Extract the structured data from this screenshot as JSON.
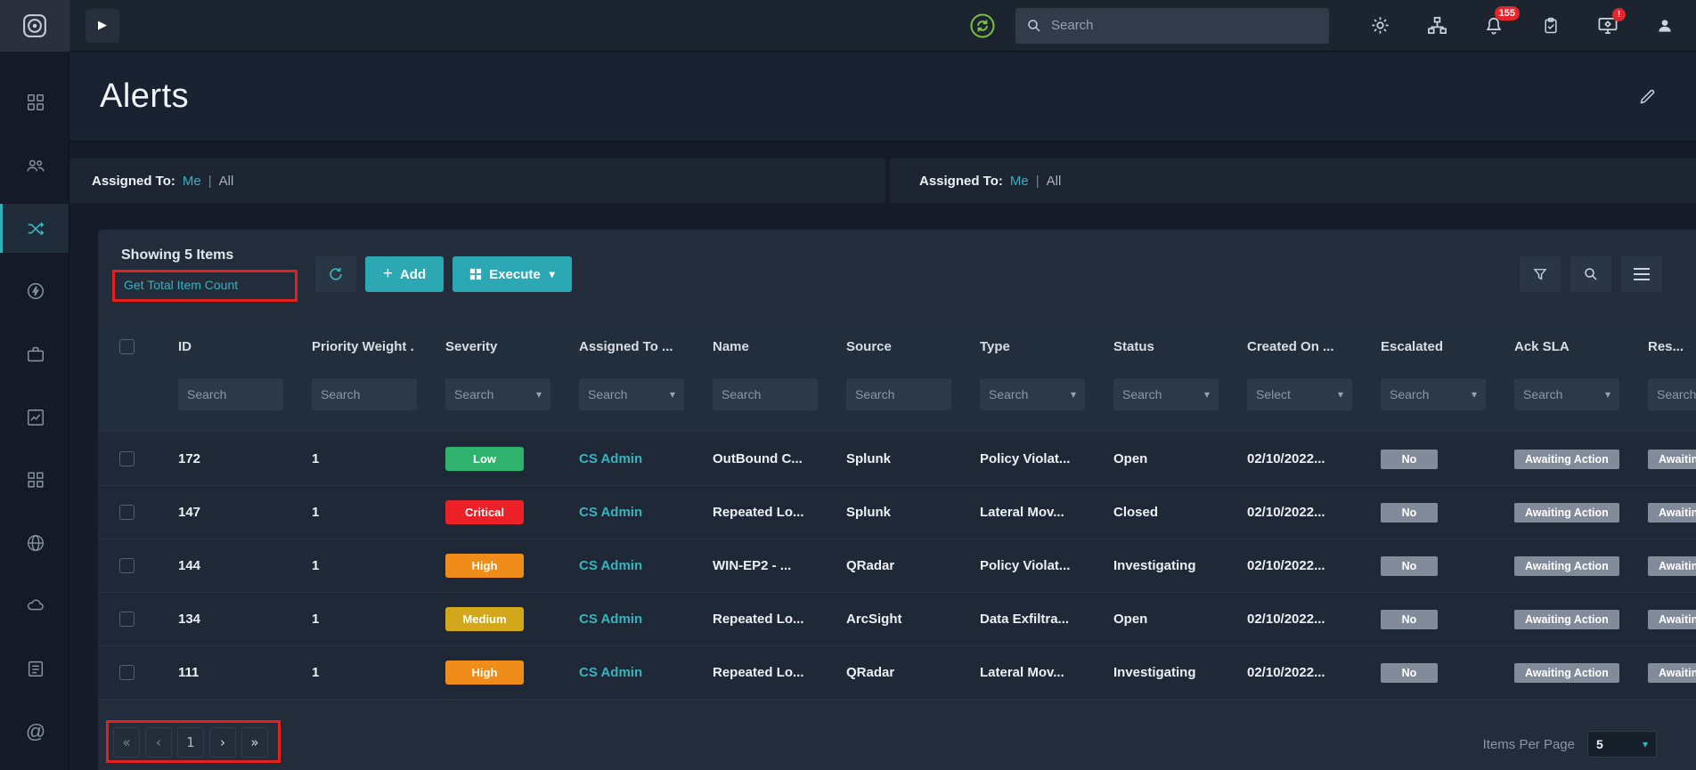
{
  "topbar": {
    "search_placeholder": "Search",
    "notification_badge": "155",
    "alert_badge": "!"
  },
  "sidebar": {
    "active_item": "shuffle",
    "items": [
      "dashboard",
      "teams",
      "shuffle",
      "power",
      "briefcase",
      "analytics",
      "apps",
      "globe",
      "cloud",
      "tasks",
      "mentions"
    ]
  },
  "page": {
    "title": "Alerts"
  },
  "assigned_filters": {
    "label": "Assigned To:",
    "me": "Me",
    "separator": "|",
    "all": "All"
  },
  "toolbar": {
    "showing_text": "Showing 5 Items",
    "get_total_link": "Get Total Item Count",
    "add_label": "Add",
    "execute_label": "Execute"
  },
  "table": {
    "search_placeholder": "Search",
    "select_placeholder": "Select",
    "columns": [
      {
        "key": "id",
        "label": "ID",
        "filter": "search"
      },
      {
        "key": "priority_weight",
        "label": "Priority Weight .",
        "filter": "search"
      },
      {
        "key": "severity",
        "label": "Severity",
        "filter": "search-dropdown"
      },
      {
        "key": "assigned_to",
        "label": "Assigned To  ...",
        "filter": "search-dropdown"
      },
      {
        "key": "name",
        "label": "Name",
        "filter": "search"
      },
      {
        "key": "source",
        "label": "Source",
        "filter": "search"
      },
      {
        "key": "type",
        "label": "Type",
        "filter": "search-dropdown"
      },
      {
        "key": "status",
        "label": "Status",
        "filter": "search-dropdown"
      },
      {
        "key": "created_on",
        "label": "Created On  ...",
        "filter": "select-dropdown"
      },
      {
        "key": "escalated",
        "label": "Escalated",
        "filter": "search-dropdown"
      },
      {
        "key": "ack_sla",
        "label": "Ack SLA",
        "filter": "search-dropdown"
      },
      {
        "key": "res_sla",
        "label": "Res...",
        "filter": "search-dropdown"
      }
    ],
    "severity_colors": {
      "Low": "#2fb26e",
      "Critical": "#ec2127",
      "High": "#f08c1a",
      "Medium": "#d2a71b"
    },
    "gray_badge_color": "#828b99",
    "rows": [
      {
        "id": "172",
        "priority_weight": "1",
        "severity": "Low",
        "assigned_to": "CS Admin",
        "name": "OutBound C...",
        "source": "Splunk",
        "type": "Policy Violat...",
        "status": "Open",
        "created_on": "02/10/2022...",
        "escalated": "No",
        "ack_sla": "Awaiting Action",
        "res_sla": "Awaiting Action"
      },
      {
        "id": "147",
        "priority_weight": "1",
        "severity": "Critical",
        "assigned_to": "CS Admin",
        "name": "Repeated Lo...",
        "source": "Splunk",
        "type": "Lateral Mov...",
        "status": "Closed",
        "created_on": "02/10/2022...",
        "escalated": "No",
        "ack_sla": "Awaiting Action",
        "res_sla": "Awaiting Action"
      },
      {
        "id": "144",
        "priority_weight": "1",
        "severity": "High",
        "assigned_to": "CS Admin",
        "name": "WIN-EP2 - ...",
        "source": "QRadar",
        "type": "Policy Violat...",
        "status": "Investigating",
        "created_on": "02/10/2022...",
        "escalated": "No",
        "ack_sla": "Awaiting Action",
        "res_sla": "Awaiting Action"
      },
      {
        "id": "134",
        "priority_weight": "1",
        "severity": "Medium",
        "assigned_to": "CS Admin",
        "name": "Repeated Lo...",
        "source": "ArcSight",
        "type": "Data Exfiltra...",
        "status": "Open",
        "created_on": "02/10/2022...",
        "escalated": "No",
        "ack_sla": "Awaiting Action",
        "res_sla": "Awaiting Action"
      },
      {
        "id": "111",
        "priority_weight": "1",
        "severity": "High",
        "assigned_to": "CS Admin",
        "name": "Repeated Lo...",
        "source": "QRadar",
        "type": "Lateral Mov...",
        "status": "Investigating",
        "created_on": "02/10/2022...",
        "escalated": "No",
        "ack_sla": "Awaiting Action",
        "res_sla": "Awaiting Action"
      }
    ]
  },
  "pagination": {
    "first": "«",
    "prev": "‹",
    "page": "1",
    "next": "›",
    "last": "»",
    "items_per_page_label": "Items Per Page",
    "items_per_page_value": "5"
  },
  "icons": {
    "caret_down": "▾",
    "play": "▶",
    "plus": "+",
    "at": "@"
  },
  "colors": {
    "accent_teal": "#35b0ba",
    "button_teal": "#2ba8b3",
    "annotation_red": "#e2211c",
    "notification_red": "#e4252b",
    "sync_green": "#7cc043"
  }
}
